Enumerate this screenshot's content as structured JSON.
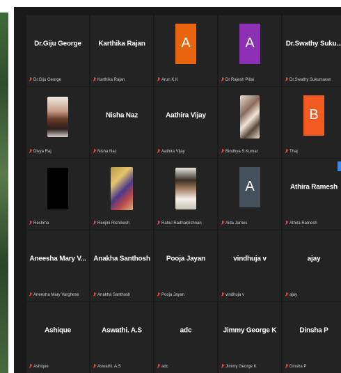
{
  "participants": [
    {
      "name": "Dr.Giju George",
      "label": "Dr.Giju George",
      "type": "name"
    },
    {
      "name": "Karthika Rajan",
      "label": "Karthika Rajan",
      "type": "name"
    },
    {
      "name": "",
      "label": "Arun K.K",
      "type": "avatar",
      "initial": "A",
      "color": "#e8640e"
    },
    {
      "name": "",
      "label": "Dr Rajesh Pillai",
      "type": "avatar",
      "initial": "A",
      "color": "#8b2fb5"
    },
    {
      "name": "Dr.Swathy Suku...",
      "label": "Dr.Swathy Sukumaran",
      "type": "name"
    },
    {
      "name": "",
      "label": "Divya Raj",
      "type": "photo",
      "photo": "divya"
    },
    {
      "name": "Nisha Naz",
      "label": "Nisha Naz",
      "type": "name"
    },
    {
      "name": "Aathira Vijay",
      "label": "Aathira Vijay",
      "type": "name"
    },
    {
      "name": "",
      "label": "Bindhya S Kumar",
      "type": "photo",
      "photo": "bindhya"
    },
    {
      "name": "",
      "label": "Thaj",
      "type": "avatar",
      "initial": "B",
      "color": "#f25a22"
    },
    {
      "name": "",
      "label": "Reshma",
      "type": "photo",
      "photo": "rashmi"
    },
    {
      "name": "",
      "label": "Renjini Rishikesh",
      "type": "photo",
      "photo": "renjini"
    },
    {
      "name": "",
      "label": "Rahul Radhakrishnan",
      "type": "photo",
      "photo": "rahul"
    },
    {
      "name": "",
      "label": "Aida James",
      "type": "avatar",
      "initial": "A",
      "color": "#44505a"
    },
    {
      "name": "Athira Ramesh",
      "label": "Athira Ramesh",
      "type": "name"
    },
    {
      "name": "Aneesha Mary V...",
      "label": "Aneesha Mary Varghese",
      "type": "name"
    },
    {
      "name": "Anakha Santhosh",
      "label": "Anakha Santhosh",
      "type": "name"
    },
    {
      "name": "Pooja Jayan",
      "label": "Pooja Jayan",
      "type": "name"
    },
    {
      "name": "vindhuja v",
      "label": "vindhuja v",
      "type": "name"
    },
    {
      "name": "ajay",
      "label": "ajay",
      "type": "name"
    },
    {
      "name": "Ashique",
      "label": "Ashique",
      "type": "name"
    },
    {
      "name": "Aswathi. A.S",
      "label": "Aswathi. A.S",
      "type": "name"
    },
    {
      "name": "adc",
      "label": "adc",
      "type": "name"
    },
    {
      "name": "Jimmy George K",
      "label": "Jimmy George K",
      "type": "name"
    },
    {
      "name": "Dinsha P",
      "label": "Dinsha P",
      "type": "name"
    }
  ],
  "colors": {
    "background": "#1a1a1a",
    "tile": "#232323",
    "muted": "#e0453a",
    "accent": "#2d8cff"
  }
}
